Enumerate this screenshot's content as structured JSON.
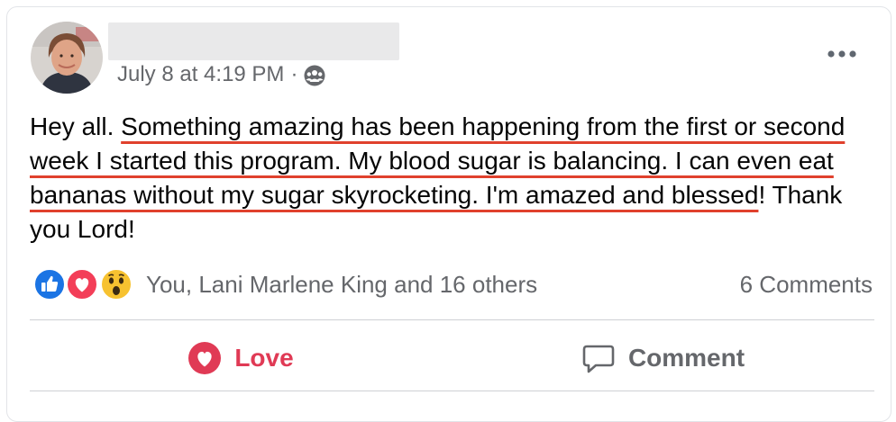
{
  "post": {
    "timestamp": "July 8 at 4:19 PM",
    "separator": "·",
    "privacy_icon": "group-audience-icon",
    "text_intro": "Hey all. ",
    "text_highlighted": "Something amazing has been happening from the first or second week I started this program. My blood sugar is balancing. I can even eat bananas without my sugar skyrocketing. I'm amazed and blessed",
    "text_outro": "! Thank you Lord!",
    "highlight_color": "#e0412d"
  },
  "reactions": {
    "icons": [
      "like-icon",
      "love-icon",
      "wow-icon"
    ],
    "summary": "You, Lani Marlene King and 16 others",
    "comments": "6 Comments"
  },
  "actions": {
    "love_label": "Love",
    "comment_label": "Comment",
    "love_color": "#e03a55"
  }
}
